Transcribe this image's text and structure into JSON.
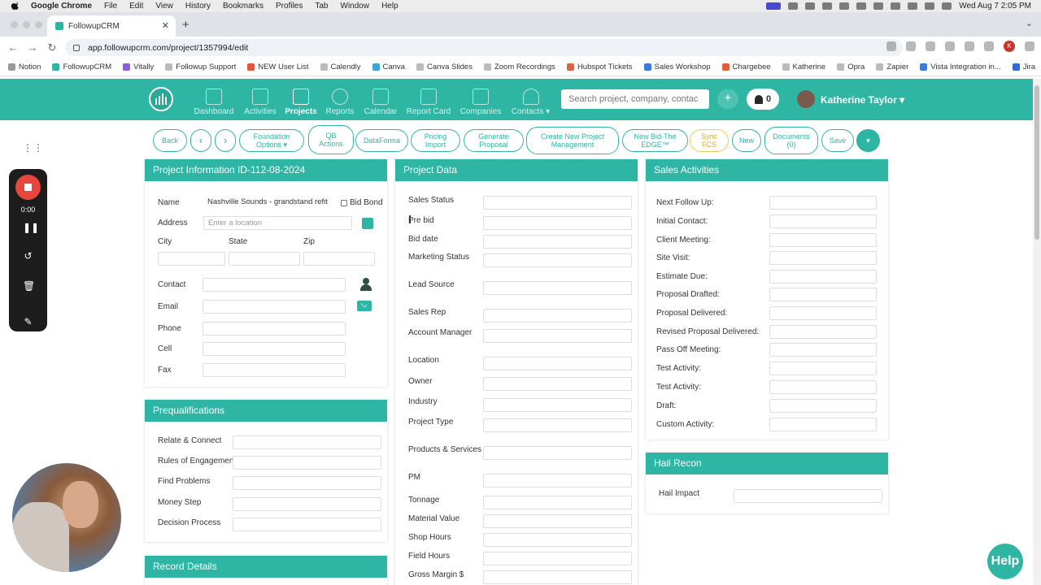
{
  "menubar": {
    "app": "Google Chrome",
    "items": [
      "File",
      "Edit",
      "View",
      "History",
      "Bookmarks",
      "Profiles",
      "Tab",
      "Window",
      "Help"
    ],
    "clock": "Wed Aug 7  2:05 PM"
  },
  "browser": {
    "tab_title": "FollowupCRM",
    "url": "app.followupcrm.com/project/1357994/edit",
    "bookmarks": [
      "Notion",
      "FollowupCRM",
      "Vitally",
      "Followup Support",
      "NEW User List",
      "Calendly",
      "Canva",
      "Canva Slides",
      "Zoom Recordings",
      "Hubspot Tickets",
      "Sales Workshop",
      "Chargebee",
      "Katherine",
      "Opra",
      "Zapier",
      "Vista Integration in...",
      "Jira"
    ],
    "profile_initial": "K"
  },
  "nav": {
    "items": [
      "Dashboard",
      "Activities",
      "Projects",
      "Reports",
      "Calendar",
      "Report Card",
      "Companies",
      "Contacts"
    ],
    "active": "Projects",
    "search_placeholder": "Search project, company, contac",
    "notifications": "0",
    "user": "Katherine Taylor"
  },
  "toolbar": {
    "back": "Back",
    "prev": "‹",
    "next": "›",
    "foundation": "Foundation Options ▾",
    "qb": "QB Actions",
    "dataforma": "DataForma",
    "pricing": "Pricing Import",
    "generate": "Generate Proposal",
    "create": "Create New Project Management",
    "bidthe": "New Bid-The EDGE™",
    "sync": "Sync FCS",
    "new": "New",
    "documents": "Documents (0)",
    "save": "Save",
    "more": "▾"
  },
  "recorder": {
    "time": "0:00"
  },
  "project_info": {
    "title": "Project Information ID-112-08-2024",
    "name_label": "Name",
    "name_value": "Nashville Sounds - grandstand refit",
    "bid_bond": "Bid Bond",
    "address_label": "Address",
    "address_placeholder": "Enter a location",
    "city": "City",
    "state": "State",
    "zip": "Zip",
    "contact": "Contact",
    "email": "Email",
    "phone": "Phone",
    "cell": "Cell",
    "fax": "Fax"
  },
  "prequal": {
    "title": "Prequalifications",
    "items": [
      "Relate & Connect",
      "Rules of Engagement",
      "Find Problems",
      "Money Step",
      "Decision Process"
    ]
  },
  "record_details": {
    "title": "Record Details"
  },
  "project_data": {
    "title": "Project Data",
    "fields": [
      "Sales Status",
      "Pre bid",
      "Bid date",
      "Marketing Status",
      "Lead Source",
      "Sales Rep",
      "Account Manager",
      "Location",
      "Owner",
      "Industry",
      "Project Type",
      "Products & Services",
      "PM",
      "Tonnage",
      "Material Value",
      "Shop Hours",
      "Field Hours",
      "Gross Margin $"
    ]
  },
  "sales_activities": {
    "title": "Sales Activities",
    "fields": [
      "Next Follow Up:",
      "Initial Contact:",
      "Client Meeting:",
      "Site Visit:",
      "Estimate Due:",
      "Proposal Drafted:",
      "Proposal Delivered:",
      "Revised Proposal Delivered:",
      "Pass Off Meeting:",
      "Test Activity:",
      "Test Activity:",
      "Draft:",
      "Custom Activity:"
    ]
  },
  "hail_recon": {
    "title": "Hail Recon",
    "field": "Hail Impact"
  },
  "help": "Help",
  "colors": {
    "brand": "#2fb5a4",
    "record": "#e8453c"
  }
}
